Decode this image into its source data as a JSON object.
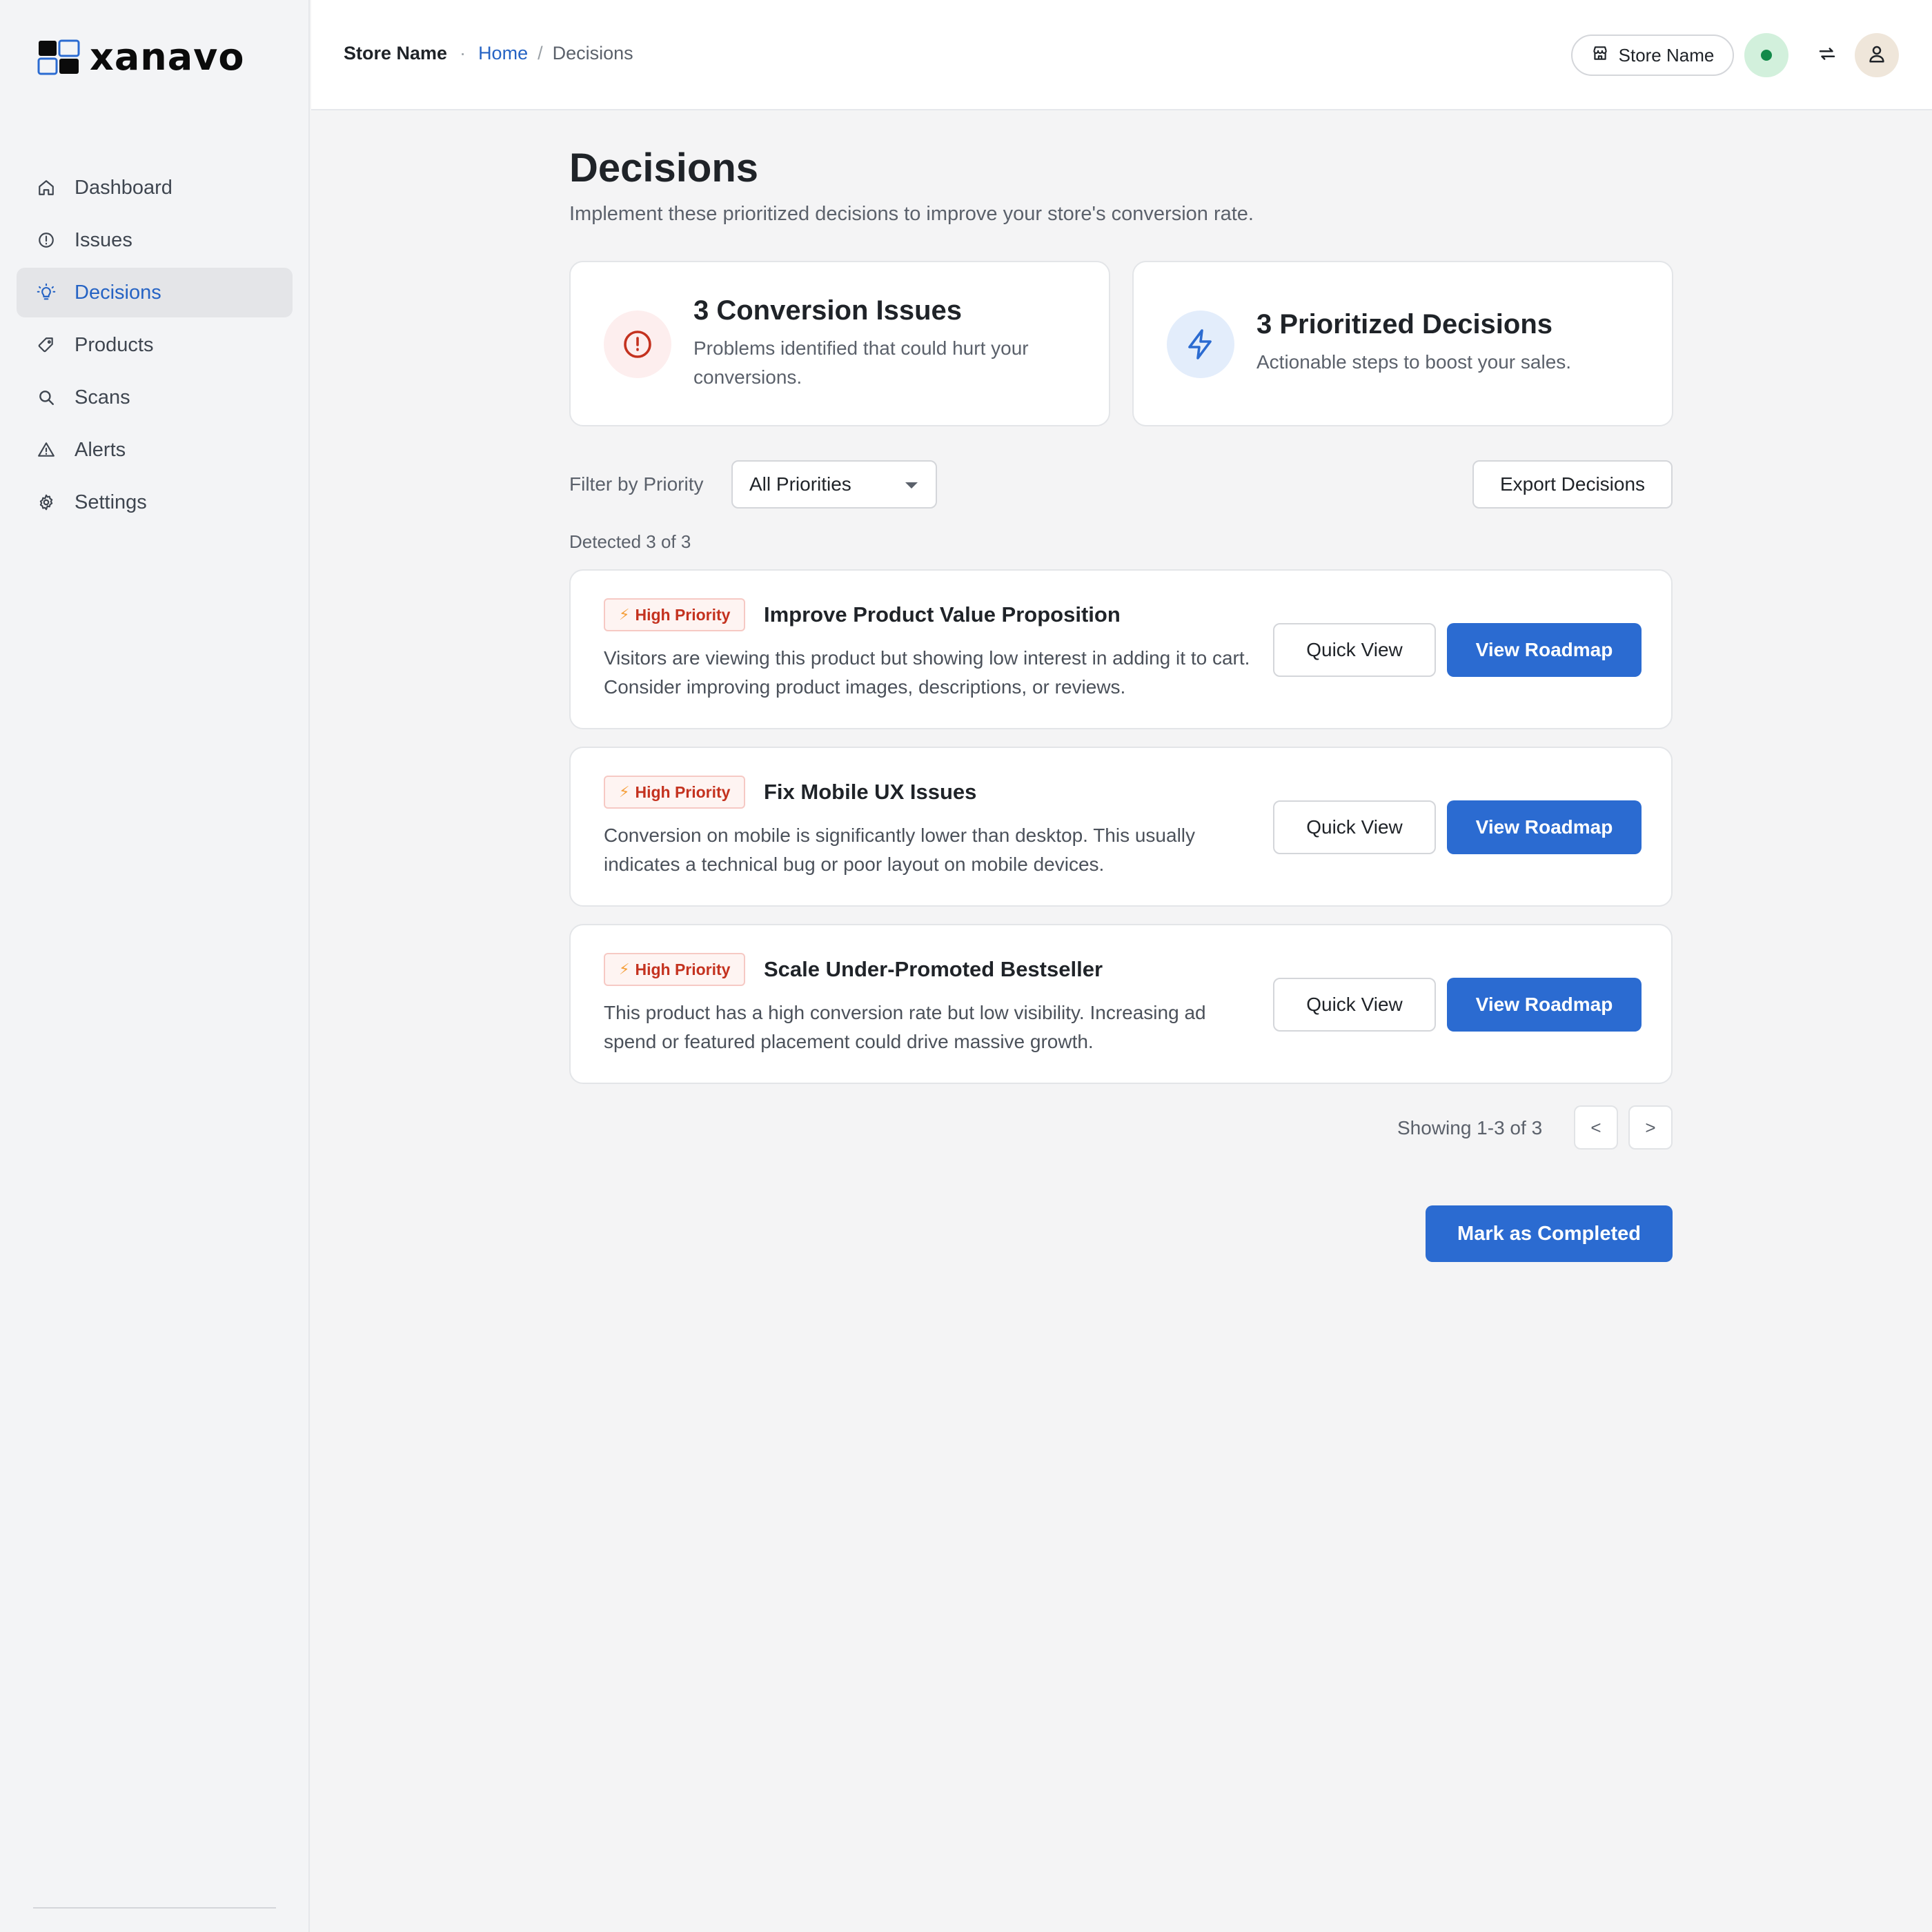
{
  "brand": {
    "name": "xanavo"
  },
  "sidebar": {
    "items": [
      {
        "label": "Dashboard",
        "icon": "home-icon",
        "active": false
      },
      {
        "label": "Issues",
        "icon": "alert-circle-icon",
        "active": false
      },
      {
        "label": "Decisions",
        "icon": "lightbulb-icon",
        "active": true
      },
      {
        "label": "Products",
        "icon": "tag-icon",
        "active": false
      },
      {
        "label": "Scans",
        "icon": "search-icon",
        "active": false
      },
      {
        "label": "Alerts",
        "icon": "warning-triangle-icon",
        "active": false
      },
      {
        "label": "Settings",
        "icon": "gear-icon",
        "active": false
      }
    ]
  },
  "header": {
    "store_name": "Store Name",
    "breadcrumb": {
      "separator_dot": "·",
      "home": "Home",
      "separator": "/",
      "current": "Decisions"
    },
    "store_selector": "Store Name",
    "status_color": "#138a4a"
  },
  "page": {
    "title": "Decisions",
    "subtitle": "Implement these prioritized decisions to improve your store's conversion rate."
  },
  "stats": {
    "issues": {
      "title": "3 Conversion Issues",
      "description": "Problems identified that could hurt your conversions.",
      "icon": "alert-circle-icon",
      "color": "#c4321f"
    },
    "decisions": {
      "title": "3 Prioritized Decisions",
      "description": "Actionable steps to boost your sales.",
      "icon": "lightning-icon",
      "color": "#2b6bd1"
    }
  },
  "filter": {
    "label": "Filter by Priority",
    "selected": "All Priorities"
  },
  "export_label": "Export Decisions",
  "detected_text": "Detected 3 of 3",
  "decisions": [
    {
      "badge": "High Priority",
      "title": "Improve Product Value Proposition",
      "description": "Visitors are viewing this product but showing low interest in adding it to cart. Consider improving product images, descriptions, or reviews.",
      "quick_view": "Quick View",
      "roadmap": "View Roadmap"
    },
    {
      "badge": "High Priority",
      "title": "Fix Mobile UX Issues",
      "description": "Conversion on mobile is significantly lower than desktop. This usually indicates a technical bug or poor layout on mobile devices.",
      "quick_view": "Quick View",
      "roadmap": "View Roadmap"
    },
    {
      "badge": "High Priority",
      "title": "Scale Under-Promoted Bestseller",
      "description": "This product has a high conversion rate but low visibility. Increasing ad spend or featured placement could drive massive growth.",
      "quick_view": "Quick View",
      "roadmap": "View Roadmap"
    }
  ],
  "pagination": {
    "showing": "Showing 1-3 of 3",
    "prev": "<",
    "next": ">"
  },
  "complete_label": "Mark as Completed",
  "colors": {
    "accent": "#2b6bd1",
    "danger": "#c4321f",
    "sidebar_bg": "#f3f4f6",
    "page_bg": "#f4f4f5"
  }
}
